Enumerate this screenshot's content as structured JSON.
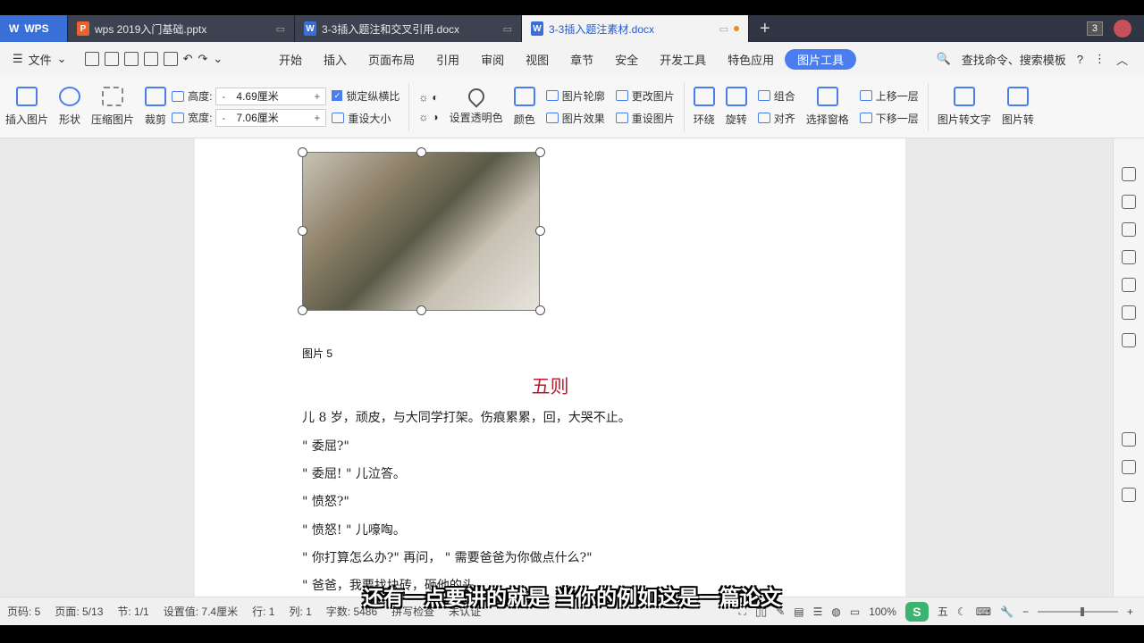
{
  "tabs": [
    {
      "label": "WPS"
    },
    {
      "label": "wps 2019入门基础.pptx",
      "type": "P",
      "color": "#e8622c"
    },
    {
      "label": "3-3插入题注和交叉引用.docx",
      "type": "W",
      "color": "#3a6fd8"
    },
    {
      "label": "3-3插入题注素材.docx",
      "type": "W",
      "color": "#3a6fd8"
    }
  ],
  "window_badge": "3",
  "menu": {
    "file": "文件",
    "items": [
      "开始",
      "插入",
      "页面布局",
      "引用",
      "审阅",
      "视图",
      "章节",
      "安全",
      "开发工具",
      "特色应用"
    ],
    "active": "图片工具",
    "search": "查找命令、搜索模板",
    "help": "?"
  },
  "ribbon": {
    "insert_picture": "插入图片",
    "shape": "形状",
    "compress": "压缩图片",
    "crop": "裁剪",
    "height_label": "高度:",
    "height_value": "4.69厘米",
    "width_label": "宽度:",
    "width_value": "7.06厘米",
    "lock_ratio": "锁定纵横比",
    "reset_size": "重设大小",
    "set_transparent": "设置透明色",
    "color": "颜色",
    "picture_outline": "图片轮廓",
    "picture_effect": "图片效果",
    "change_picture": "更改图片",
    "reset_picture": "重设图片",
    "wrap": "环绕",
    "rotate": "旋转",
    "group": "组合",
    "align": "对齐",
    "selection_pane": "选择窗格",
    "bring_forward": "上移一层",
    "send_backward": "下移一层",
    "pic_to_text": "图片转文字",
    "pic_more": "图片转"
  },
  "document": {
    "caption": "图片 5",
    "heading": "五则",
    "paragraphs": [
      "儿 8 岁，顽皮，与大同学打架。伤痕累累，回，大哭不止。",
      "\" 委屈?\"",
      "\" 委屈! \" 儿泣答。",
      "\" 愤怒?\"",
      "\" 愤怒! \" 儿嚎啕。",
      "\" 你打算怎么办?\" 再问， \" 需要爸爸为你做点什么?\"",
      "\" 爸爸，我要找块砖，砸他的头..."
    ]
  },
  "status": {
    "page_num": "页码: 5",
    "pages": "页面: 5/13",
    "section": "节: 1/1",
    "setting": "设置值: 7.4厘米",
    "line": "行: 1",
    "col": "列: 1",
    "words": "字数: 5486",
    "spell": "拼写检查",
    "cert": "未认证",
    "zoom": "100%",
    "wps_s": "S",
    "ime": "五"
  },
  "subtitle": "还有一点要讲的就是 当你的例如这是一篇论文"
}
